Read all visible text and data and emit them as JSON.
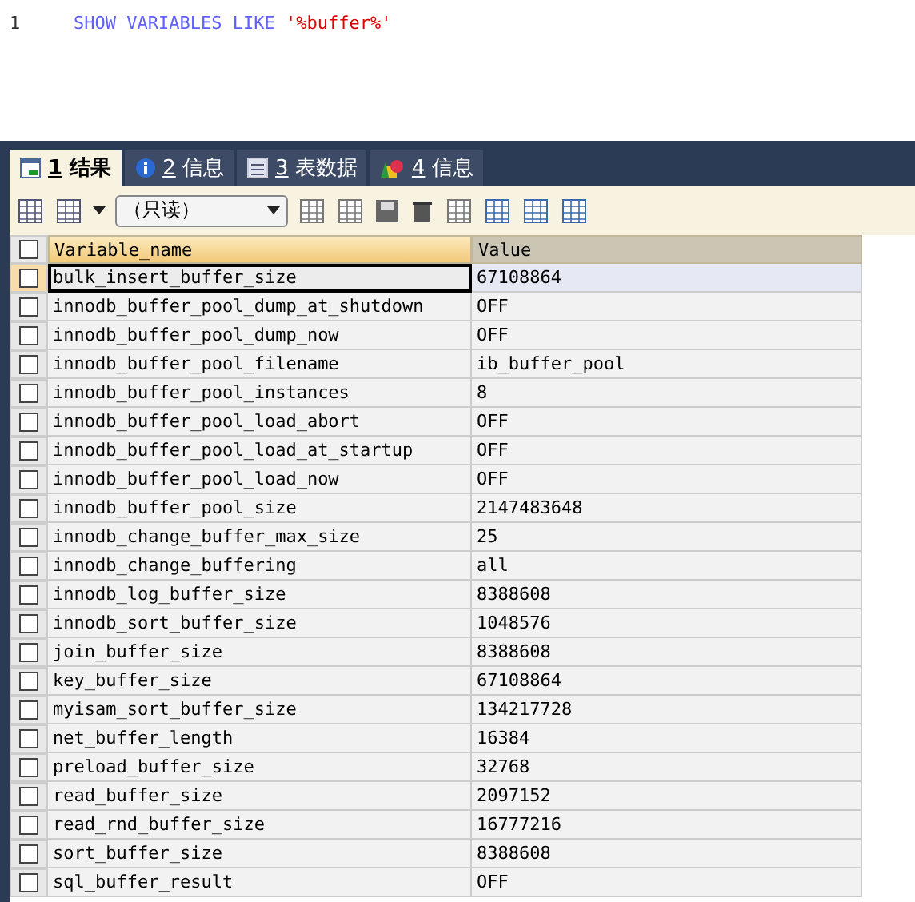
{
  "editor": {
    "lines": [
      {
        "number": "1",
        "keyword": "SHOW VARIABLES LIKE",
        "literal": "'%buffer%'"
      }
    ]
  },
  "tabs": [
    {
      "number": "1",
      "label": "结果",
      "selected": true,
      "kind": "grid"
    },
    {
      "number": "2",
      "label": "信息",
      "selected": false,
      "kind": "info"
    },
    {
      "number": "3",
      "label": "表数据",
      "selected": false,
      "kind": "table"
    },
    {
      "number": "4",
      "label": "信息",
      "selected": false,
      "kind": "shapes"
    }
  ],
  "toolbar": {
    "mode": "（只读）"
  },
  "table": {
    "select_all_checked": false,
    "columns": [
      "Variable_name",
      "Value"
    ],
    "rows": [
      {
        "cells": [
          "bulk_insert_buffer_size",
          "67108864"
        ],
        "selected": true
      },
      {
        "cells": [
          "innodb_buffer_pool_dump_at_shutdown",
          "OFF"
        ],
        "selected": false
      },
      {
        "cells": [
          "innodb_buffer_pool_dump_now",
          "OFF"
        ],
        "selected": false
      },
      {
        "cells": [
          "innodb_buffer_pool_filename",
          "ib_buffer_pool"
        ],
        "selected": false
      },
      {
        "cells": [
          "innodb_buffer_pool_instances",
          "8"
        ],
        "selected": false
      },
      {
        "cells": [
          "innodb_buffer_pool_load_abort",
          "OFF"
        ],
        "selected": false
      },
      {
        "cells": [
          "innodb_buffer_pool_load_at_startup",
          "OFF"
        ],
        "selected": false
      },
      {
        "cells": [
          "innodb_buffer_pool_load_now",
          "OFF"
        ],
        "selected": false
      },
      {
        "cells": [
          "innodb_buffer_pool_size",
          "2147483648"
        ],
        "selected": false
      },
      {
        "cells": [
          "innodb_change_buffer_max_size",
          "25"
        ],
        "selected": false
      },
      {
        "cells": [
          "innodb_change_buffering",
          "all"
        ],
        "selected": false
      },
      {
        "cells": [
          "innodb_log_buffer_size",
          "8388608"
        ],
        "selected": false
      },
      {
        "cells": [
          "innodb_sort_buffer_size",
          "1048576"
        ],
        "selected": false
      },
      {
        "cells": [
          "join_buffer_size",
          "8388608"
        ],
        "selected": false
      },
      {
        "cells": [
          "key_buffer_size",
          "67108864"
        ],
        "selected": false
      },
      {
        "cells": [
          "myisam_sort_buffer_size",
          "134217728"
        ],
        "selected": false
      },
      {
        "cells": [
          "net_buffer_length",
          "16384"
        ],
        "selected": false
      },
      {
        "cells": [
          "preload_buffer_size",
          "32768"
        ],
        "selected": false
      },
      {
        "cells": [
          "read_buffer_size",
          "2097152"
        ],
        "selected": false
      },
      {
        "cells": [
          "read_rnd_buffer_size",
          "16777216"
        ],
        "selected": false
      },
      {
        "cells": [
          "sort_buffer_size",
          "8388608"
        ],
        "selected": false
      },
      {
        "cells": [
          "sql_buffer_result",
          "OFF"
        ],
        "selected": false
      }
    ]
  }
}
